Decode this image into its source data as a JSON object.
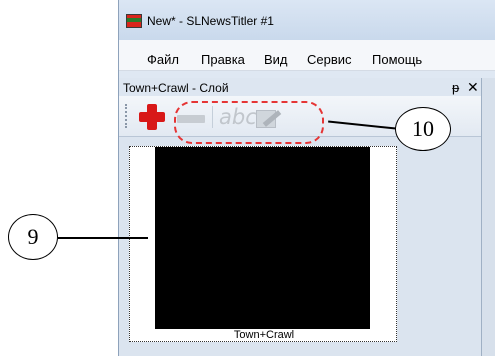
{
  "window": {
    "title": "New* - SLNewsTitler #1",
    "app_icon": "slnewstitler-app-icon"
  },
  "menu": {
    "items": [
      "Файл",
      "Правка",
      "Вид",
      "Сервис",
      "Помощь"
    ]
  },
  "panel": {
    "title": "Town+Crawl - Слой",
    "pin_glyph": "ᵽ",
    "close_glyph": "✕"
  },
  "toolbar": {
    "add_icon": "red-plus-icon",
    "remove_icon": "minus-icon",
    "rename_label": "abc",
    "edit_icon": "edit-icon"
  },
  "preview": {
    "caption": "Town+Crawl"
  },
  "callouts": {
    "preview_number": "9",
    "toolbar_number": "10"
  },
  "colors": {
    "highlight_dash": "#e53535",
    "preview_screen": "#000000"
  }
}
